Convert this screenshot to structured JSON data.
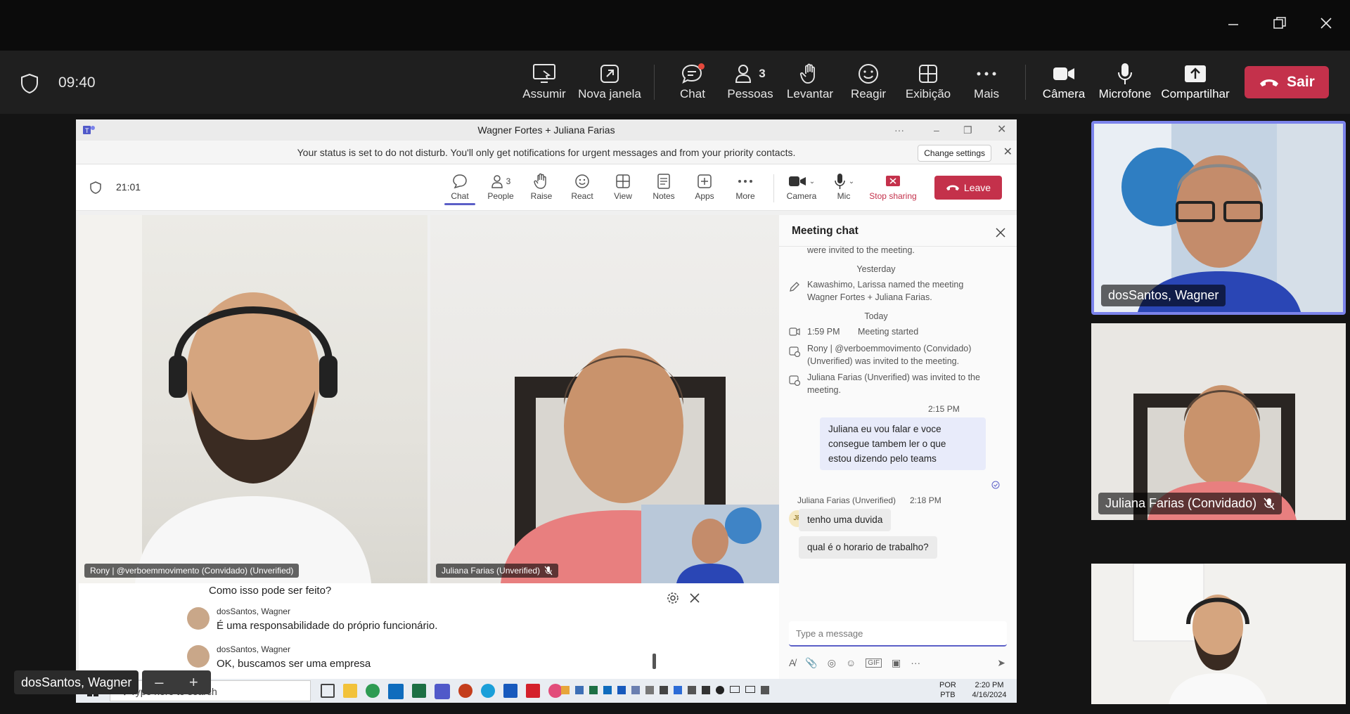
{
  "titlebar": {},
  "toolbar": {
    "time": "09:40",
    "buttons": [
      {
        "label": "Assumir",
        "icon": "assume-icon"
      },
      {
        "label": "Nova janela",
        "icon": "pop-out-icon"
      },
      {
        "label": "Chat",
        "icon": "chat-icon"
      },
      {
        "label": "Pessoas",
        "icon": "people-icon",
        "badge": "3"
      },
      {
        "label": "Levantar",
        "icon": "raise-hand-icon"
      },
      {
        "label": "Reagir",
        "icon": "react-icon"
      },
      {
        "label": "Exibição",
        "icon": "view-icon"
      },
      {
        "label": "Mais",
        "icon": "more-icon"
      },
      {
        "label": "Câmera",
        "icon": "camera-icon"
      },
      {
        "label": "Microfone",
        "icon": "microphone-icon"
      },
      {
        "label": "Compartilhar",
        "icon": "share-icon"
      }
    ],
    "leave_label": "Sair"
  },
  "shared": {
    "window_title": "Wagner Fortes + Juliana Farias",
    "dnd_message": "Your status is set to do not disturb. You'll only get notifications for urgent messages and from your priority contacts.",
    "change_settings": "Change settings",
    "timer": "21:01",
    "toolbar": [
      {
        "label": "Chat"
      },
      {
        "label": "People",
        "badge": "3"
      },
      {
        "label": "Raise"
      },
      {
        "label": "React"
      },
      {
        "label": "View"
      },
      {
        "label": "Notes"
      },
      {
        "label": "Apps"
      },
      {
        "label": "More"
      },
      {
        "label": "Camera"
      },
      {
        "label": "Mic"
      },
      {
        "label": "Stop sharing"
      }
    ],
    "leave_label": "Leave",
    "tiles": {
      "rony": "Rony | @verboemmovimento (Convidado) (Unverified)",
      "juliana": "Juliana Farias (Unverified)"
    },
    "chat": {
      "title": "Meeting chat",
      "invited_top": "were invited to the meeting.",
      "yesterday": "Yesterday",
      "renamed_1": "Kawashimo, Larissa named the meeting",
      "renamed_2": "Wagner Fortes + Juliana Farias.",
      "today": "Today",
      "started_time": "1:59 PM",
      "started": "Meeting started",
      "rony_invited_1": "Rony | @verboemmovimento (Convidado)",
      "rony_invited_2": "(Unverified) was invited to the meeting.",
      "juliana_invited_1": "Juliana Farias (Unverified) was invited to the",
      "juliana_invited_2": "meeting.",
      "sent_time": "2:15 PM",
      "sent_1": "Juliana eu vou falar e voce",
      "sent_2": "consegue tambem ler o que",
      "sent_3": "estou dizendo pelo teams",
      "in_sender": "Juliana Farias (Unverified)",
      "in_time": "2:18 PM",
      "in_initials": "JF",
      "in_msg_1": "tenho uma duvida",
      "in_msg_2": "qual é o horario de trabalho?",
      "input_placeholder": "Type a message"
    },
    "captions": [
      {
        "speaker": "",
        "text": "Como isso pode ser feito?"
      },
      {
        "speaker": "dosSantos, Wagner",
        "text": "É uma responsabilidade do próprio funcionário."
      },
      {
        "speaker": "dosSantos, Wagner",
        "text": "OK, buscamos ser uma empresa"
      }
    ],
    "taskbar": {
      "search_placeholder": "Type here to search",
      "lang_1": "POR",
      "lang_2": "PTB",
      "time": "2:20 PM",
      "date": "4/16/2024"
    }
  },
  "participants": [
    {
      "name": "dosSantos, Wagner",
      "muted": false
    },
    {
      "name": "Juliana Farias (Convidado)",
      "muted": true
    },
    {
      "name": "",
      "muted": false
    }
  ],
  "self_label": "dosSantos, Wagner",
  "colors": {
    "accent": "#7b83eb",
    "leave": "#c4314b",
    "toolbar": "#1f1f1f"
  }
}
